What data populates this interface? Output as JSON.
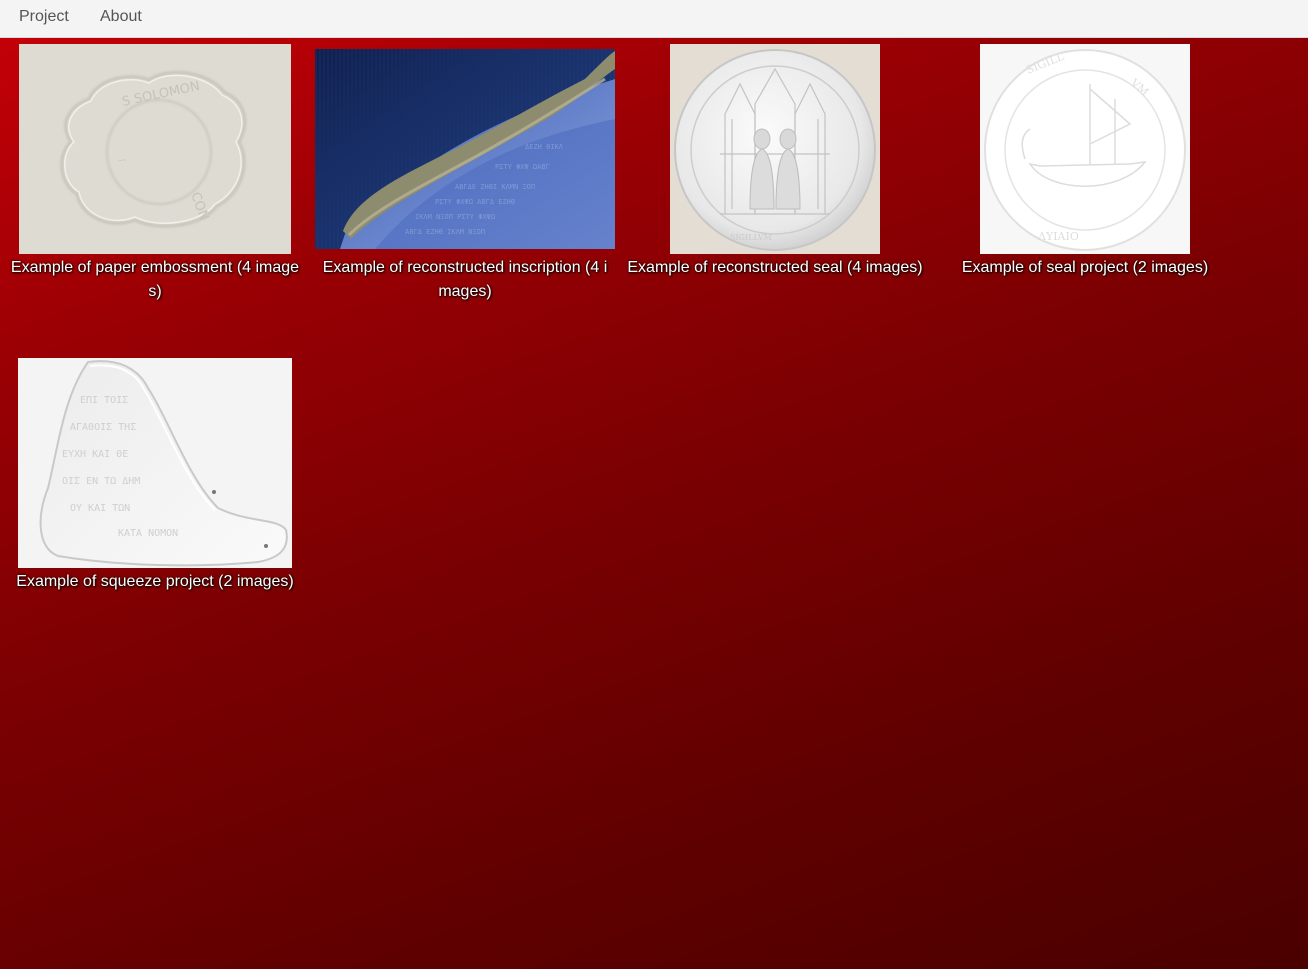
{
  "nav": {
    "items": [
      {
        "label": "Project"
      },
      {
        "label": "About"
      }
    ]
  },
  "gallery": {
    "items": [
      {
        "caption": "Example of paper embossment (4 images)",
        "thumbnail": "paper-embossment-thumbnail"
      },
      {
        "caption": "Example of reconstructed inscription (4 images)",
        "thumbnail": "reconstructed-inscription-thumbnail"
      },
      {
        "caption": "Example of reconstructed seal (4 images)",
        "thumbnail": "reconstructed-seal-thumbnail"
      },
      {
        "caption": "Example of seal project (2 images)",
        "thumbnail": "seal-project-thumbnail"
      },
      {
        "caption": "Example of squeeze project (2 images)",
        "thumbnail": "squeeze-project-thumbnail"
      }
    ]
  },
  "colors": {
    "background_top": "#c80008",
    "background_bottom": "#4a0000",
    "navbar": "#f4f4f4",
    "caption_text": "#ffffff"
  }
}
